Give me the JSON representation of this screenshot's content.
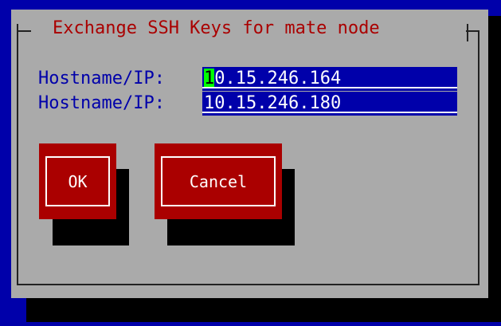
{
  "dialog": {
    "title": "Exchange SSH Keys for mate node"
  },
  "fields": [
    {
      "label": "Hostname/IP:",
      "value_first_char": "1",
      "value_rest": "0.15.246.164"
    },
    {
      "label": "Hostname/IP:",
      "value": "10.15.246.180"
    }
  ],
  "buttons": {
    "ok_label": "OK",
    "cancel_label": "Cancel"
  },
  "colors": {
    "background": "#0000aa",
    "dialog": "#aaaaaa",
    "accent": "#aa0000",
    "input_bg": "#0000aa",
    "cursor": "#00ff00"
  }
}
